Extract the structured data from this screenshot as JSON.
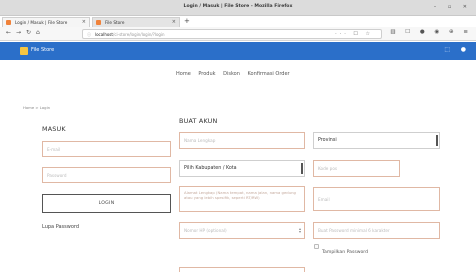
{
  "browser": {
    "window_title": "Login / Masuk | File Store - Mozilla Firefox",
    "tabs": [
      {
        "label": "Login / Masuk | File Store"
      },
      {
        "label": "File Store"
      }
    ],
    "url_host": "localhost",
    "url_path": "/ci-store/login/login/?login"
  },
  "site": {
    "brand": "File Store",
    "menu": [
      "Home",
      "Produk",
      "Diskon",
      "Konfirmasi Order"
    ],
    "breadcrumb": "Home > Login"
  },
  "login": {
    "heading": "MASUK",
    "email_placeholder": "E-mail",
    "password_placeholder": "Password",
    "button_label": "LOGIN",
    "forgot_label": "Lupa Password"
  },
  "register": {
    "heading": "BUAT AKUN",
    "name_placeholder": "Nama Lengkap",
    "province_value": "Provinsi",
    "city_value": "Pilih Kabupaten / Kota",
    "postcode_placeholder": "Kode pos",
    "address_placeholder": "Alamat Lengkap (Nama tempat, nama jalan, nama gedung atau yang lebih spesifik, seperti RT/RW)",
    "email_placeholder": "Email",
    "phone_placeholder": "Nomor HP (optional)",
    "password_placeholder": "Buat Password minimal 6 karakter",
    "show_password_label": "Tampilkan Password"
  },
  "colors": {
    "header_blue": "#2b6fc9",
    "input_border": "#e0b8a4"
  }
}
